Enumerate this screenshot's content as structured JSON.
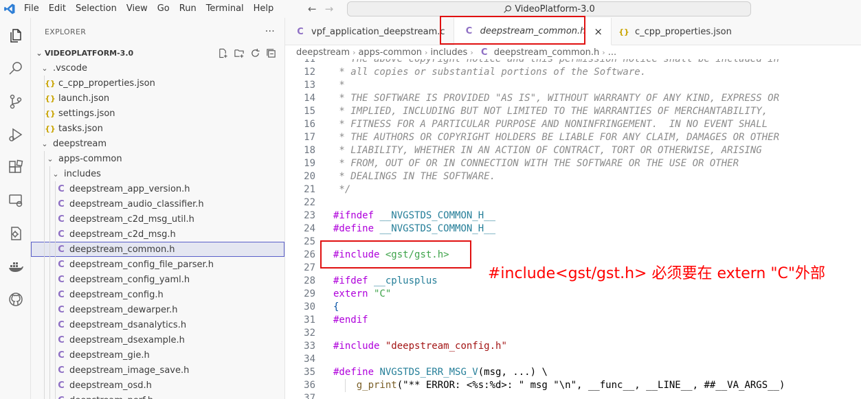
{
  "titlebar": {
    "menu": [
      {
        "label": "File"
      },
      {
        "label": "Edit"
      },
      {
        "label": "Selection"
      },
      {
        "label": "View"
      },
      {
        "label": "Go"
      },
      {
        "label": "Run"
      },
      {
        "label": "Terminal"
      },
      {
        "label": "Help"
      }
    ],
    "command_center": "VideoPlatform-3.0"
  },
  "sidebar": {
    "header": "EXPLORER",
    "more": "···",
    "project": "VIDEOPLATFORM-3.0",
    "items": [
      {
        "label": ".vscode",
        "kind": "folder"
      },
      {
        "label": "c_cpp_properties.json",
        "kind": "json"
      },
      {
        "label": "launch.json",
        "kind": "json"
      },
      {
        "label": "settings.json",
        "kind": "json"
      },
      {
        "label": "tasks.json",
        "kind": "json"
      },
      {
        "label": "deepstream",
        "kind": "folder"
      },
      {
        "label": "apps-common",
        "kind": "folder"
      },
      {
        "label": "includes",
        "kind": "folder"
      },
      {
        "label": "deepstream_app_version.h",
        "kind": "c"
      },
      {
        "label": "deepstream_audio_classifier.h",
        "kind": "c"
      },
      {
        "label": "deepstream_c2d_msg_util.h",
        "kind": "c"
      },
      {
        "label": "deepstream_c2d_msg.h",
        "kind": "c"
      },
      {
        "label": "deepstream_common.h",
        "kind": "c",
        "selected": true
      },
      {
        "label": "deepstream_config_file_parser.h",
        "kind": "c"
      },
      {
        "label": "deepstream_config_yaml.h",
        "kind": "c"
      },
      {
        "label": "deepstream_config.h",
        "kind": "c"
      },
      {
        "label": "deepstream_dewarper.h",
        "kind": "c"
      },
      {
        "label": "deepstream_dsanalytics.h",
        "kind": "c"
      },
      {
        "label": "deepstream_dsexample.h",
        "kind": "c"
      },
      {
        "label": "deepstream_gie.h",
        "kind": "c"
      },
      {
        "label": "deepstream_image_save.h",
        "kind": "c"
      },
      {
        "label": "deepstream_osd.h",
        "kind": "c"
      },
      {
        "label": "deepstream_perf.h",
        "kind": "c"
      }
    ]
  },
  "tabs": [
    {
      "label": "vpf_application_deepstream.c",
      "icon": "C"
    },
    {
      "label": "deepstream_common.h",
      "icon": "C",
      "active": true,
      "close": "×"
    },
    {
      "label": "c_cpp_properties.json",
      "icon": "{}"
    }
  ],
  "breadcrumb": {
    "parts": [
      "deepstream",
      "apps-common",
      "includes",
      "deepstream_common.h",
      "..."
    ],
    "file_icon": "C"
  },
  "editor": {
    "lines": [
      {
        "n": "11",
        "text": " * The above copyright notice and this permission notice shall be included in"
      },
      {
        "n": "12",
        "text": " * all copies or substantial portions of the Software."
      },
      {
        "n": "13",
        "text": " *"
      },
      {
        "n": "14",
        "text": " * THE SOFTWARE IS PROVIDED \"AS IS\", WITHOUT WARRANTY OF ANY KIND, EXPRESS OR"
      },
      {
        "n": "15",
        "text": " * IMPLIED, INCLUDING BUT NOT LIMITED TO THE WARRANTIES OF MERCHANTABILITY,"
      },
      {
        "n": "16",
        "text": " * FITNESS FOR A PARTICULAR PURPOSE AND NONINFRINGEMENT.  IN NO EVENT SHALL"
      },
      {
        "n": "17",
        "text": " * THE AUTHORS OR COPYRIGHT HOLDERS BE LIABLE FOR ANY CLAIM, DAMAGES OR OTHER"
      },
      {
        "n": "18",
        "text": " * LIABILITY, WHETHER IN AN ACTION OF CONTRACT, TORT OR OTHERWISE, ARISING"
      },
      {
        "n": "19",
        "text": " * FROM, OUT OF OR IN CONNECTION WITH THE SOFTWARE OR THE USE OR OTHER"
      },
      {
        "n": "20",
        "text": " * DEALINGS IN THE SOFTWARE."
      },
      {
        "n": "21",
        "text": " */"
      },
      {
        "n": "22"
      },
      {
        "n": "23",
        "kw": "#ifndef",
        "rest": " __NVGSTDS_COMMON_H__"
      },
      {
        "n": "24",
        "kw": "#define",
        "rest": " __NVGSTDS_COMMON_H__"
      },
      {
        "n": "25"
      },
      {
        "n": "26",
        "kw": "#include",
        "str": " <gst/gst.h>"
      },
      {
        "n": "27"
      },
      {
        "n": "28",
        "kw": "#ifdef",
        "rest": " __cplusplus"
      },
      {
        "n": "29",
        "kw2": "extern",
        "str2": " \"C\""
      },
      {
        "n": "30",
        "brace": "{"
      },
      {
        "n": "31",
        "kw": "#endif"
      },
      {
        "n": "32"
      },
      {
        "n": "33",
        "kw": "#include",
        "str3": " \"deepstream_config.h\""
      },
      {
        "n": "34"
      },
      {
        "n": "35",
        "kw": "#define",
        "mac": " NVGSTDS_ERR_MSG_V",
        "plain": "(msg, ...) \\"
      },
      {
        "n": "36",
        "fn": "    g_print",
        "plain": "(\"** ERROR: <%s:%d>: \" msg \"\\n\", __func__, __LINE__, ##__VA_ARGS__)"
      },
      {
        "n": "37"
      }
    ]
  },
  "annotation": {
    "text": "#include<gst/gst.h> 必须要在 extern \"C\"外部",
    "color": "#ff0000"
  }
}
